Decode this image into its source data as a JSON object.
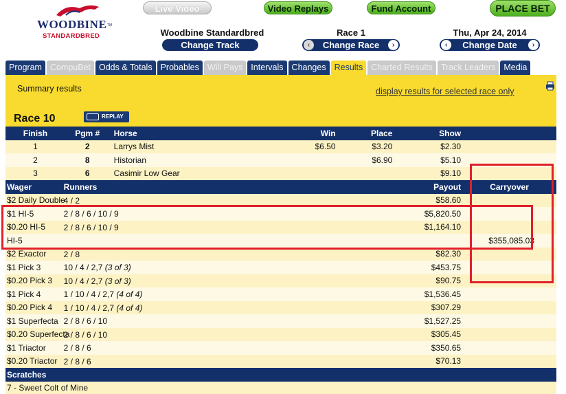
{
  "logo": {
    "word": "WOODBINE",
    "tm": "TM",
    "sub": "STANDARDBRED"
  },
  "top_buttons": {
    "live_video": "Live Video",
    "video_replays": "Video Replays",
    "fund_account": "Fund Account",
    "place_bet": "PLACE BET"
  },
  "selectors": {
    "track": {
      "title": "Woodbine Standardbred",
      "button": "Change Track"
    },
    "race": {
      "title": "Race 1",
      "button": "Change Race"
    },
    "date": {
      "title": "Thu, Apr 24, 2014",
      "button": "Change Date"
    }
  },
  "tabs": [
    {
      "label": "Program",
      "state": "normal"
    },
    {
      "label": "CompuBet",
      "state": "disabled"
    },
    {
      "label": "Odds & Totals",
      "state": "normal"
    },
    {
      "label": "Probables",
      "state": "normal"
    },
    {
      "label": "Will Pays",
      "state": "disabled"
    },
    {
      "label": "Intervals",
      "state": "normal"
    },
    {
      "label": "Changes",
      "state": "normal"
    },
    {
      "label": "Results",
      "state": "active"
    },
    {
      "label": "Charted Results",
      "state": "disabled"
    },
    {
      "label": "Track Leaders",
      "state": "disabled"
    },
    {
      "label": "Media",
      "state": "normal"
    }
  ],
  "panel": {
    "summary": "Summary results",
    "display_link": "display results for selected race only",
    "race_title": "Race 10",
    "replay": "REPLAY"
  },
  "finish_headers": {
    "finish": "Finish",
    "pgm": "Pgm #",
    "horse": "Horse",
    "win": "Win",
    "place": "Place",
    "show": "Show"
  },
  "finishers": [
    {
      "finish": "1",
      "pgm": "2",
      "horse": "Larrys Mist",
      "win": "$6.50",
      "place": "$3.20",
      "show": "$2.30"
    },
    {
      "finish": "2",
      "pgm": "8",
      "horse": "Historian",
      "win": "",
      "place": "$6.90",
      "show": "$5.10"
    },
    {
      "finish": "3",
      "pgm": "6",
      "horse": "Casimir Low Gear",
      "win": "",
      "place": "",
      "show": "$9.10"
    }
  ],
  "wager_headers": {
    "wager": "Wager",
    "runners": "Runners",
    "payout": "Payout",
    "carryover": "Carryover"
  },
  "wagers": [
    {
      "wager": "$2 Daily Double",
      "runners": "4 / 2",
      "note": "",
      "payout": "$58.60",
      "carryover": ""
    },
    {
      "wager": "$1 HI-5",
      "runners": "2 / 8 / 6 / 10 / 9",
      "note": "",
      "payout": "$5,820.50",
      "carryover": ""
    },
    {
      "wager": "$0.20 HI-5",
      "runners": "2 / 8 / 6 / 10 / 9",
      "note": "",
      "payout": "$1,164.10",
      "carryover": ""
    },
    {
      "wager": "HI-5",
      "runners": "",
      "note": "",
      "payout": "",
      "carryover": "$355,085.03"
    },
    {
      "wager": "$2 Exactor",
      "runners": "2 / 8",
      "note": "",
      "payout": "$82.30",
      "carryover": ""
    },
    {
      "wager": "$1 Pick 3",
      "runners": "10 / 4 / 2,7 ",
      "note": "(3 of 3)",
      "payout": "$453.75",
      "carryover": ""
    },
    {
      "wager": "$0.20 Pick 3",
      "runners": "10 / 4 / 2,7 ",
      "note": "(3 of 3)",
      "payout": "$90.75",
      "carryover": ""
    },
    {
      "wager": "$1 Pick 4",
      "runners": "1 / 10 / 4 / 2,7 ",
      "note": "(4 of 4)",
      "payout": "$1,536.45",
      "carryover": ""
    },
    {
      "wager": "$0.20 Pick 4",
      "runners": "1 / 10 / 4 / 2,7 ",
      "note": "(4 of 4)",
      "payout": "$307.29",
      "carryover": ""
    },
    {
      "wager": "$1 Superfecta",
      "runners": "2 / 8 / 6 / 10",
      "note": "",
      "payout": "$1,527.25",
      "carryover": ""
    },
    {
      "wager": "$0.20 Superfecta",
      "runners": "2 / 8 / 6 / 10",
      "note": "",
      "payout": "$305.45",
      "carryover": ""
    },
    {
      "wager": "$1 Triactor",
      "runners": "2 / 8 / 6",
      "note": "",
      "payout": "$350.65",
      "carryover": ""
    },
    {
      "wager": "$0.20 Triactor",
      "runners": "2 / 8 / 6",
      "note": "",
      "payout": "$70.13",
      "carryover": ""
    }
  ],
  "scratches": {
    "header": "Scratches",
    "items": [
      "7 - Sweet Colt of Mine"
    ]
  },
  "colors": {
    "navy": "#14306b",
    "panel_yellow": "#f8db2e",
    "row_light": "#fdf9e4",
    "row_mid": "#fcf2c4",
    "highlight_red": "#e0202a",
    "green_button": "#4cae1c"
  }
}
